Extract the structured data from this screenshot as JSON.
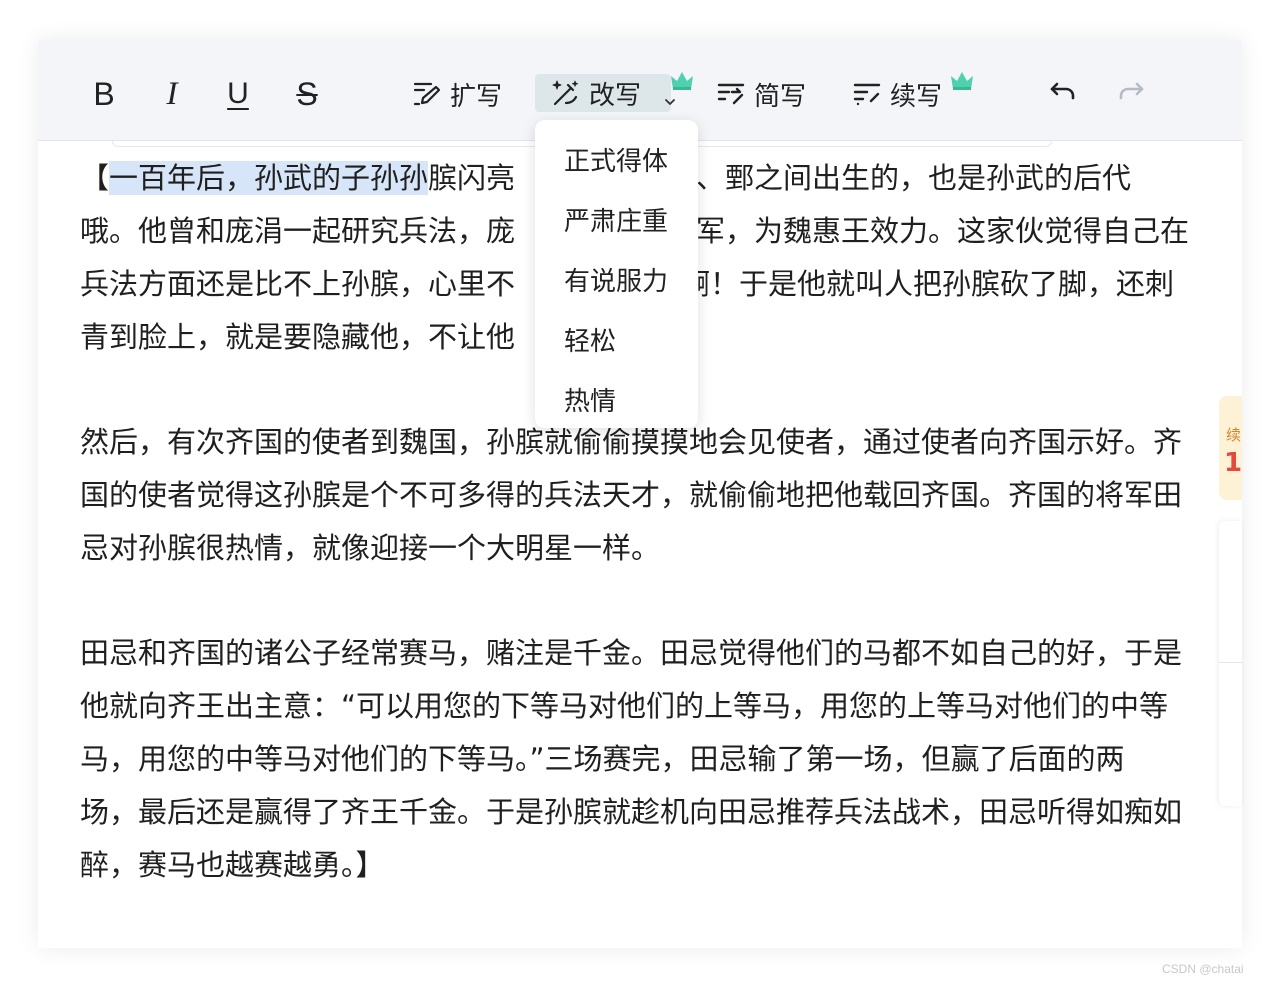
{
  "toolbar": {
    "format": {
      "bold": "B",
      "italic": "I",
      "underline": "U",
      "strike": "S"
    },
    "ai": {
      "expand": "扩写",
      "rewrite": "改写",
      "simplify": "简写",
      "continue": "续写"
    }
  },
  "rewrite_menu": {
    "items": [
      "正式得体",
      "严肃庄重",
      "有说服力",
      "轻松",
      "热情"
    ]
  },
  "editor": {
    "p1": {
      "l1_hl": "一百年后，孙武的子孙孙",
      "l1_rest": "膑闪亮",
      "l1_open": "【",
      "l1_tail": "阿、鄄之间出生的，也是孙武的后代",
      "l2a": "哦。他曾和庞涓一起研究兵法，庞",
      "l2b": "将军，为魏惠王效力。这家伙觉得自己在",
      "l3a": "兵法方面还是比不上孙膑，心里不",
      "l3b": "啊！于是他就叫人把孙膑砍了脚，还刺",
      "l4a": "青到脸上，就是要隐藏他，不让他"
    },
    "p2": {
      "l1a": "然后，有次齐国的使者到魏国，孙膑就偷偷摸摸地会见使者，通过使者向齐国示好。齐",
      "l2": "国的使者觉得这孙膑是个不可多得的兵法天才，就偷偷地把他载回齐国。齐国的将军田",
      "l3": "忌对孙膑很热情，就像迎接一个大明星一样。"
    },
    "p3": {
      "l1": "田忌和齐国的诸公子经常赛马，赌注是千金。田忌觉得他们的马都不如自己的好，于是",
      "l2": "他就向齐王出主意：“可以用您的下等马对他们的上等马，用您的上等马对他们的中等",
      "l3": "马，用您的中等马对他们的下等马。”三场赛完，田忌输了第一场，但赢了后面的两",
      "l4": "场，最后还是赢得了齐王千金。于是孙膑就趁机向田忌推荐兵法战术，田忌听得如痴如",
      "l5": "醉，赛马也越赛越勇。】"
    }
  },
  "side": {
    "badge_text": "续",
    "badge_num": "1"
  },
  "watermark": "CSDN @chatai",
  "colors": {
    "toolbar_bg": "#f4f5f9",
    "rewrite_active_bg": "#dde7e9",
    "selection": "#d6e5f7",
    "crown": "#4fd1b0",
    "redo_disabled": "#b5bcc5"
  },
  "icons": {
    "expand": "pen-expand-icon",
    "rewrite": "magic-wand-icon",
    "simplify": "lines-shorten-icon",
    "continue": "lines-plus-icon",
    "crown": "crown-icon",
    "undo": "undo-icon",
    "redo": "redo-icon"
  }
}
